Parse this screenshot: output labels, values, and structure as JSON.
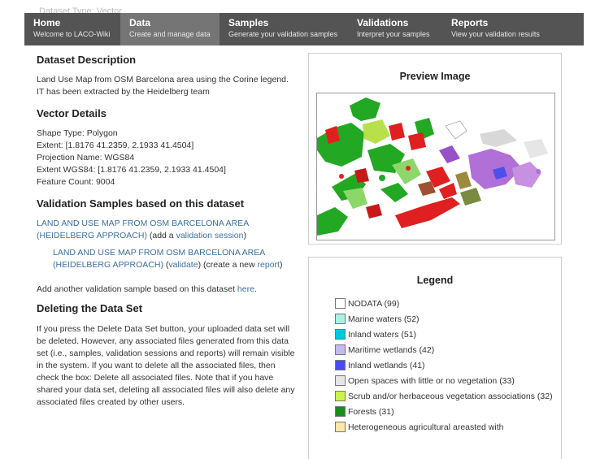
{
  "nav": [
    {
      "title": "Home",
      "subtitle": "Welcome to LACO-Wiki",
      "active": false
    },
    {
      "title": "Data",
      "subtitle": "Create and manage data",
      "active": true
    },
    {
      "title": "Samples",
      "subtitle": "Generate your validation samples",
      "active": false
    },
    {
      "title": "Validations",
      "subtitle": "Interpret your samples",
      "active": false
    },
    {
      "title": "Reports",
      "subtitle": "View your validation results",
      "active": false
    }
  ],
  "ghost_text": "Dataset Type: Vector",
  "description": {
    "heading": "Dataset Description",
    "text": "Land Use Map from OSM Barcelona area using the Corine legend. IT has been extracted by the Heidelberg team"
  },
  "vector": {
    "heading": "Vector Details",
    "shape_type": "Shape Type: Polygon",
    "extent": "Extent: [1.8176 41.2359, 2.1933 41.4504]",
    "projection": "Projection Name: WGS84",
    "extent_wgs84": "Extent WGS84: [1.8176 41.2359, 2.1933 41.4504]",
    "feature_count": "Feature Count: 9004"
  },
  "validation": {
    "heading": "Validation Samples based on this dataset",
    "sample_link": "LAND AND USE MAP FROM OSM BARCELONA AREA (HEIDELBERG APPROACH)",
    "add_prefix": "(add a ",
    "add_link": "validation session",
    "add_suffix": ")",
    "session_link": "LAND AND USE MAP FROM OSM BARCELONA AREA (HEIDELBERG APPROACH)",
    "validate_prefix": " (",
    "validate_link": "validate",
    "validate_mid": ") (create a new ",
    "report_link": "report",
    "validate_suffix": ")",
    "another_text": "Add another validation sample based on this dataset ",
    "here_link": "here",
    "another_suffix": "."
  },
  "delete": {
    "heading": "Deleting the Data Set",
    "text": "If you press the Delete Data Set button, your uploaded data set will be deleted. However, any associated files generated from this data set (i.e., samples, validation sessions and reports) will remain visible in the system. If you want to delete all the associated files, then check the box: Delete all associated files. Note that if you have shared your data set, deleting all associated files will also delete any associated files created by other users."
  },
  "preview": {
    "title": "Preview Image"
  },
  "legend": {
    "title": "Legend",
    "items": [
      {
        "label": "NODATA (99)",
        "color": "#ffffff"
      },
      {
        "label": "Marine waters (52)",
        "color": "#a6f2e6"
      },
      {
        "label": "Inland waters (51)",
        "color": "#00c6e6"
      },
      {
        "label": "Maritime wetlands (42)",
        "color": "#c6b8f2"
      },
      {
        "label": "Inland wetlands (41)",
        "color": "#4a4af2"
      },
      {
        "label": "Open spaces with little or no vegetation (33)",
        "color": "#e6e6e6"
      },
      {
        "label": "Scrub and/or herbaceous vegetation associations (32)",
        "color": "#ccf24d"
      },
      {
        "label": "Forests (31)",
        "color": "#1a8c1a"
      },
      {
        "label": "Heterogeneous agricultural areasted with",
        "color": "#ffe6a6"
      }
    ]
  }
}
